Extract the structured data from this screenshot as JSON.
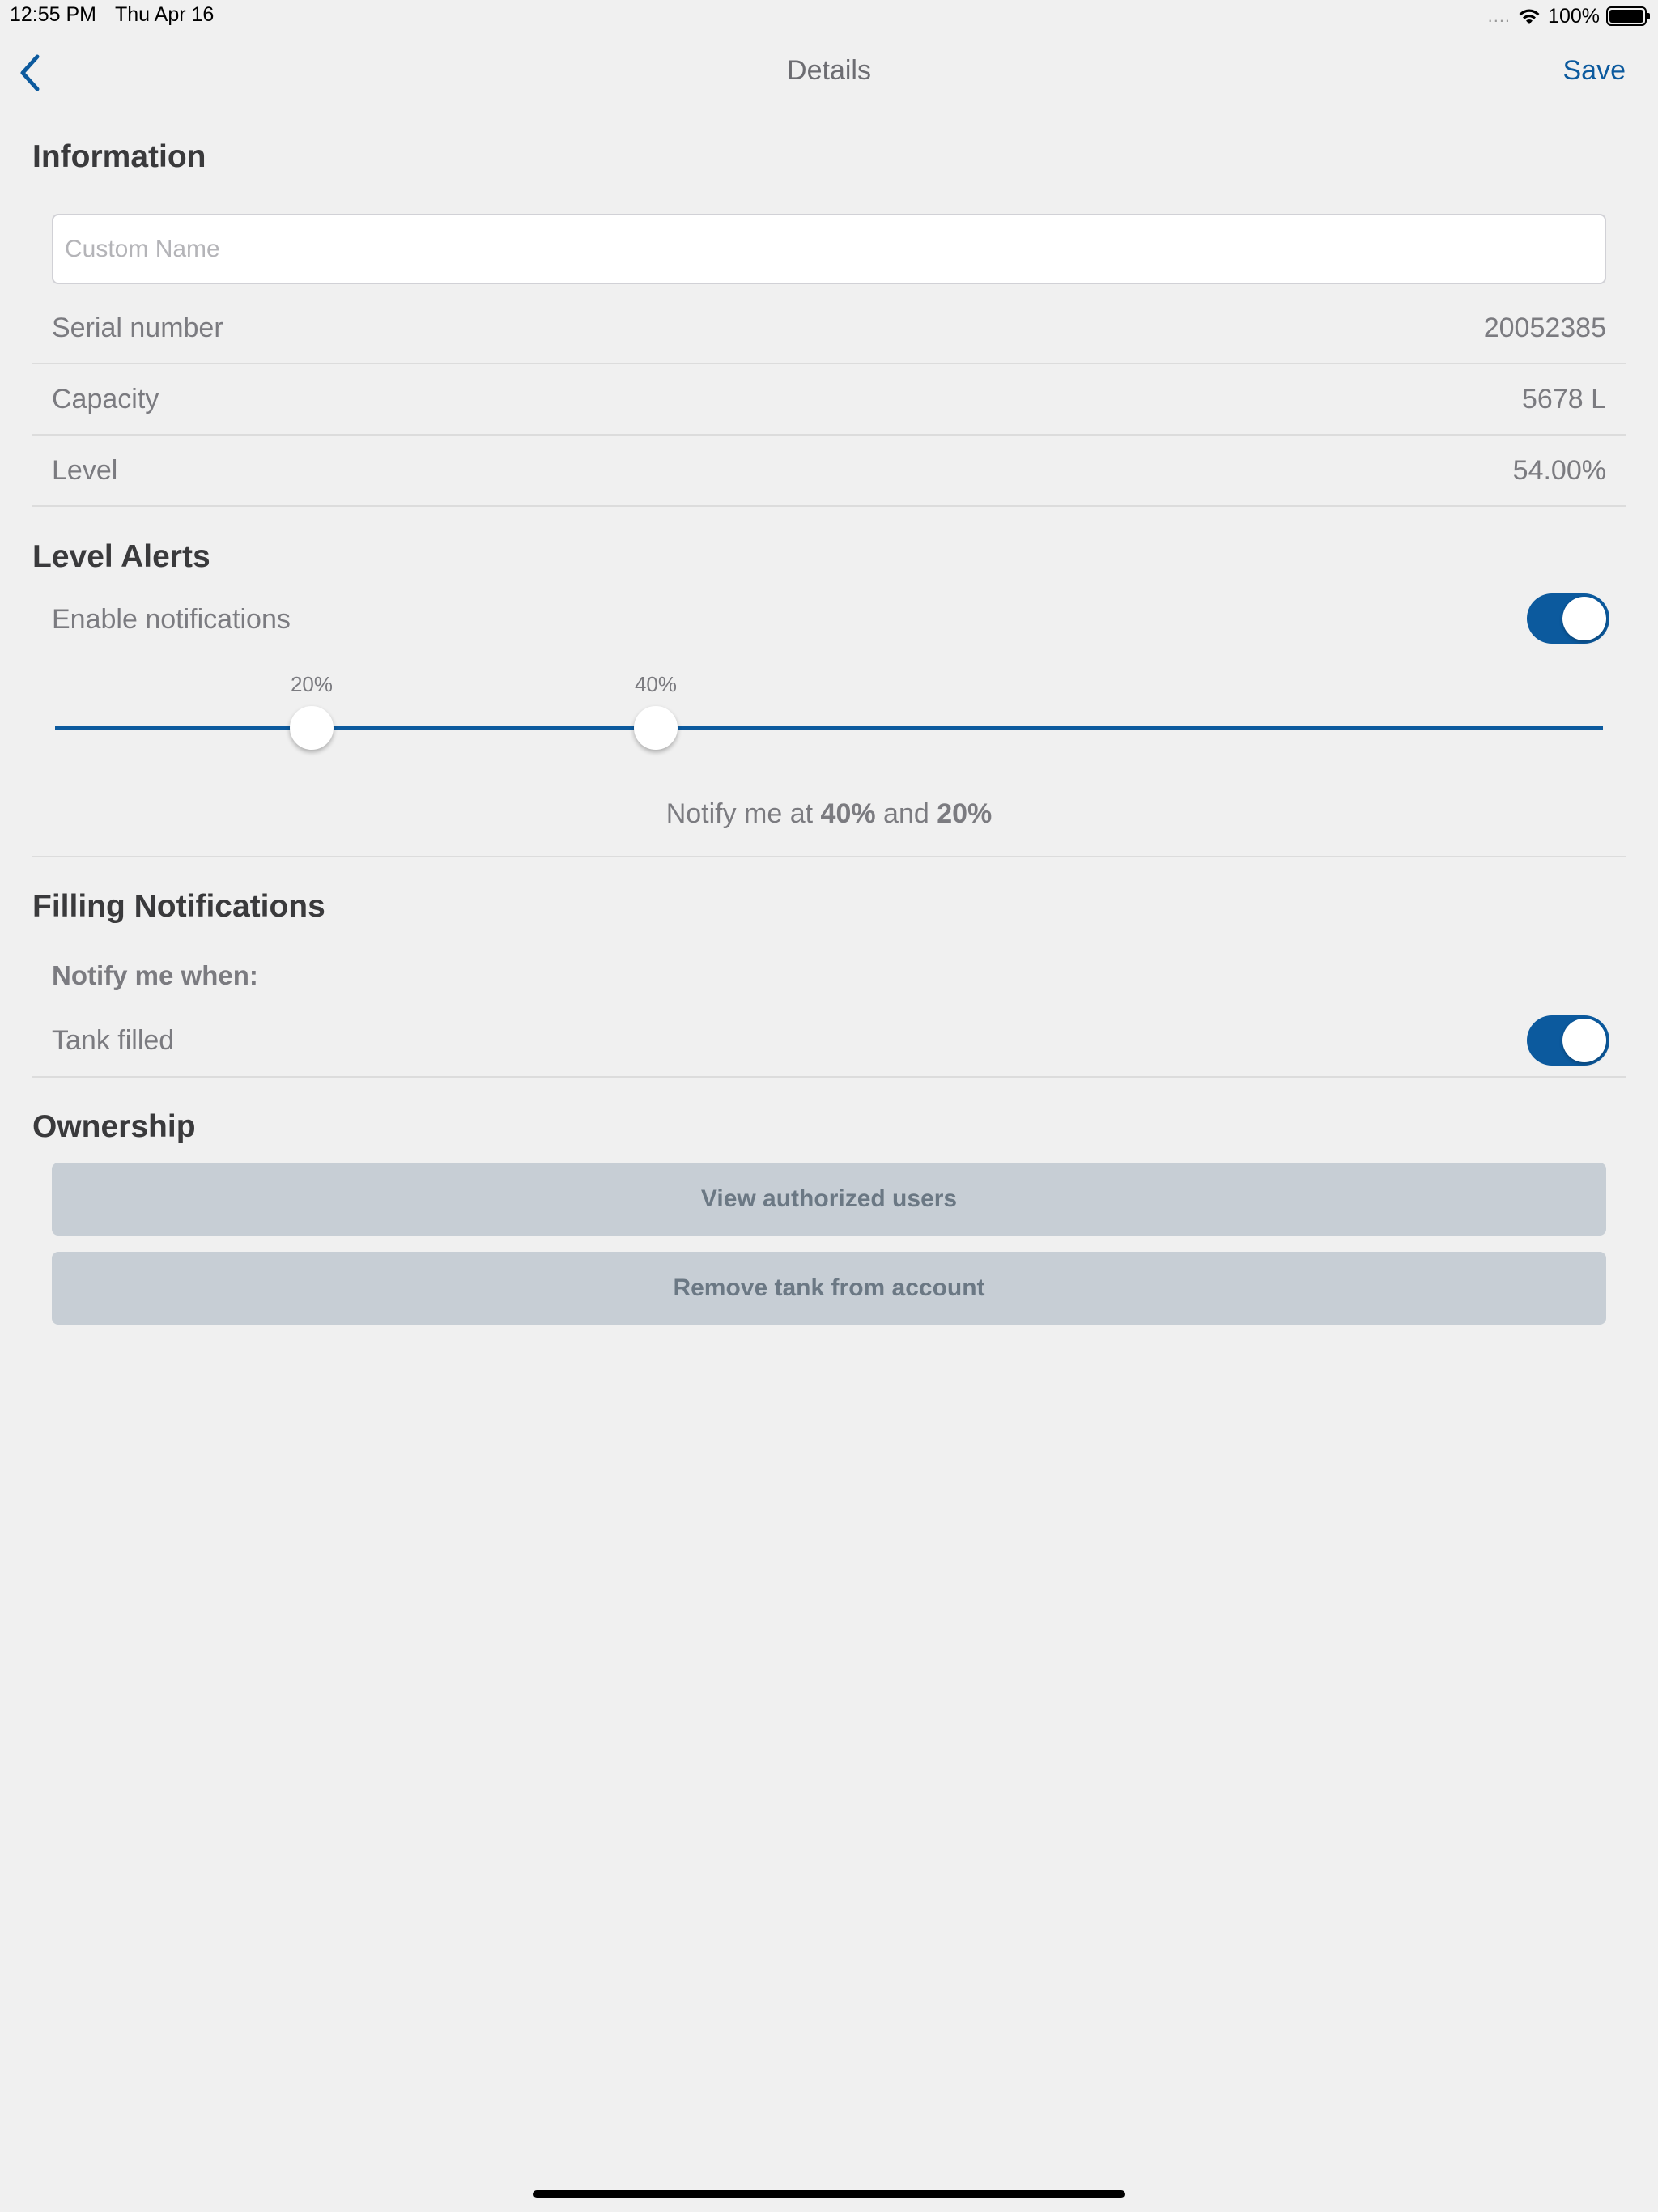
{
  "status_bar": {
    "time": "12:55 PM",
    "date": "Thu Apr 16",
    "signal": "....",
    "battery_pct": "100%",
    "wifi_icon": "wifi-icon",
    "battery_icon": "battery-icon"
  },
  "nav": {
    "title": "Details",
    "save_label": "Save",
    "back_icon": "chevron-left-icon"
  },
  "information": {
    "header": "Information",
    "custom_name_placeholder": "Custom Name",
    "custom_name_value": "",
    "rows": [
      {
        "label": "Serial number",
        "value": "20052385"
      },
      {
        "label": "Capacity",
        "value": "5678 L"
      },
      {
        "label": "Level",
        "value": "54.00%"
      }
    ]
  },
  "level_alerts": {
    "header": "Level Alerts",
    "enable_label": "Enable notifications",
    "enable_on": true,
    "thresholds": [
      {
        "label": "20%",
        "value": 20
      },
      {
        "label": "40%",
        "value": 40
      }
    ],
    "summary_prefix": "Notify me at ",
    "summary_high": "40%",
    "summary_middle": " and ",
    "summary_low": "20%"
  },
  "filling_notifications": {
    "header": "Filling Notifications",
    "subheader": "Notify me when:",
    "tank_filled_label": "Tank filled",
    "tank_filled_on": true
  },
  "ownership": {
    "header": "Ownership",
    "view_users_label": "View authorized users",
    "remove_tank_label": "Remove tank from account"
  },
  "colors": {
    "accent": "#0c5a9e",
    "background": "#f0f0f0",
    "button_bg": "#c7ced5"
  }
}
